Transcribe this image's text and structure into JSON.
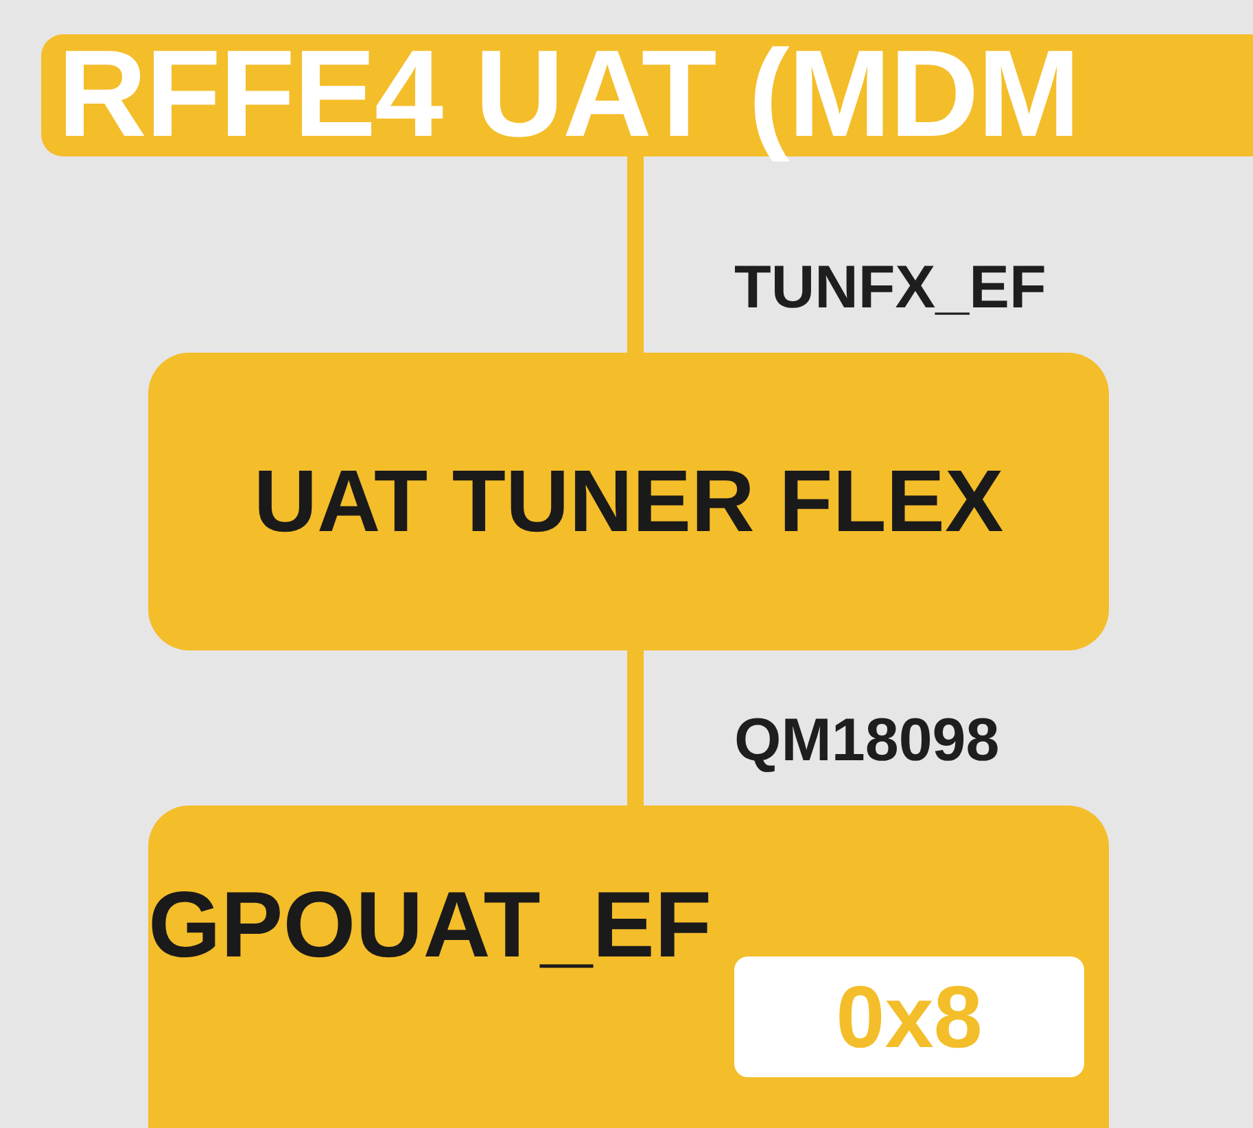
{
  "header": {
    "title": "RFFE4 UAT (MDM"
  },
  "blocks": [
    {
      "kind": "centered",
      "connector_label": "TUNFX_EF",
      "title": "UAT TUNER FLEX"
    },
    {
      "kind": "tagged",
      "connector_label": "QM18098",
      "title": "GPOUAT_EF",
      "badge": "0x8"
    }
  ]
}
